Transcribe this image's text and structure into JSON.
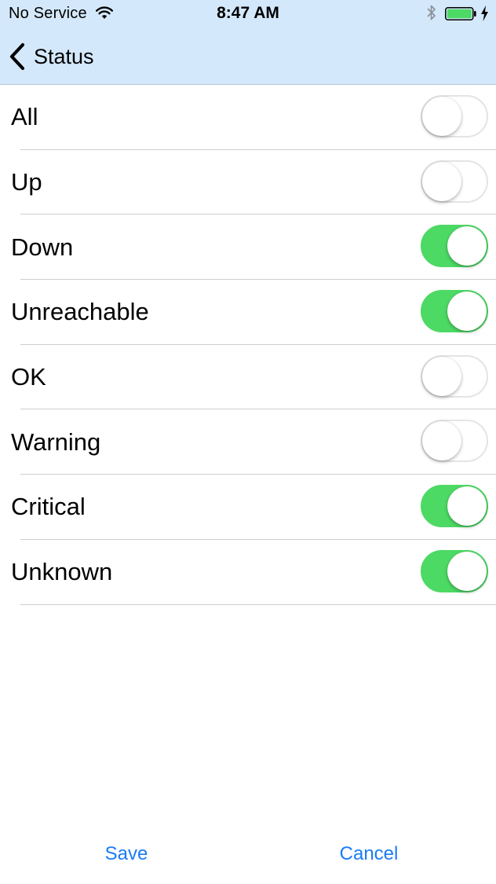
{
  "status_bar": {
    "carrier": "No Service",
    "time": "8:47 AM",
    "icons": [
      "wifi-icon",
      "bluetooth-icon",
      "battery-icon",
      "charging-bolt-icon"
    ]
  },
  "nav": {
    "back_label": "Status",
    "back_icon": "chevron-left-icon"
  },
  "colors": {
    "header_bg": "#d4e8fb",
    "switch_on": "#4cd964",
    "accent": "#1a7cf5"
  },
  "rows": [
    {
      "label": "All",
      "on": false
    },
    {
      "label": "Up",
      "on": false
    },
    {
      "label": "Down",
      "on": true
    },
    {
      "label": "Unreachable",
      "on": true
    },
    {
      "label": "OK",
      "on": false
    },
    {
      "label": "Warning",
      "on": false
    },
    {
      "label": "Critical",
      "on": true
    },
    {
      "label": "Unknown",
      "on": true
    }
  ],
  "footer": {
    "save_label": "Save",
    "cancel_label": "Cancel"
  }
}
